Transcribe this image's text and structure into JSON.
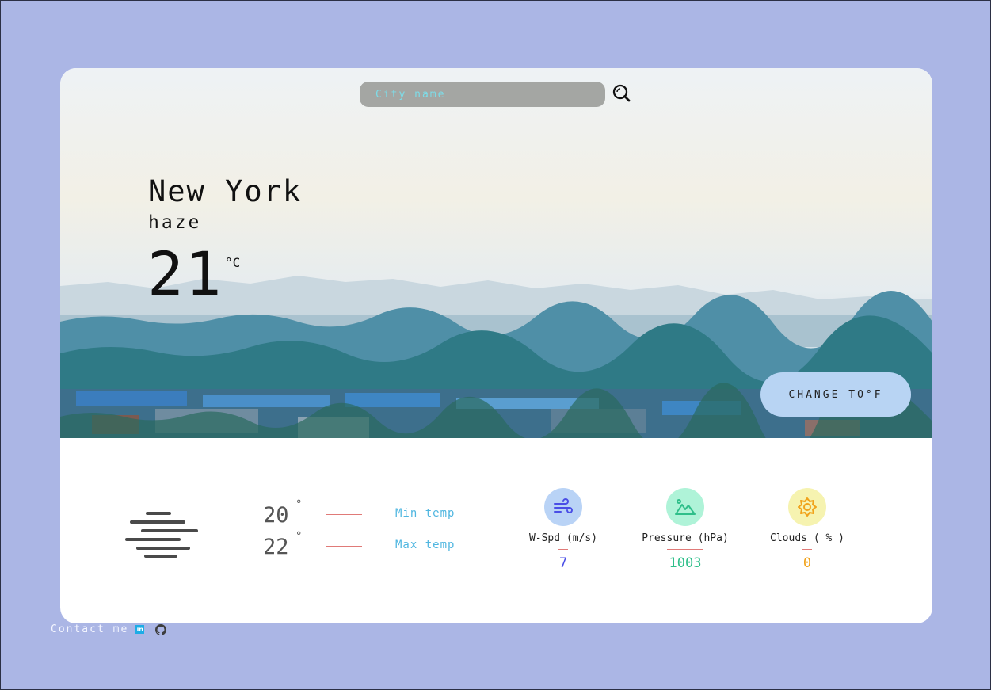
{
  "search": {
    "placeholder": "City name",
    "value": ""
  },
  "weather": {
    "city": "New York",
    "condition": "haze",
    "temperature": "21",
    "unit": "°C"
  },
  "toggle_button": {
    "label": "CHANGE TO°F"
  },
  "temps": {
    "min": {
      "value": "20",
      "deg": "°",
      "label": "Min temp"
    },
    "max": {
      "value": "22",
      "deg": "°",
      "label": "Max temp"
    }
  },
  "stats": [
    {
      "label": "W-Spd (m/s)",
      "value": "7",
      "icon": "wind-icon",
      "color": "#4a4ee6",
      "bg": "#b9d3f6"
    },
    {
      "label": "Pressure (hPa)",
      "value": "1003",
      "icon": "mountain-icon",
      "color": "#2fbf8a",
      "bg": "#aff3d8"
    },
    {
      "label": "Clouds ( % )",
      "value": "0",
      "icon": "sun-icon",
      "color": "#f1a21a",
      "bg": "#f6f3b0"
    }
  ],
  "footer": {
    "contact_label": "Contact me"
  },
  "colors": {
    "background": "#abb6e5",
    "toggle": "#b8d4f3",
    "accent_label": "#4fb6e0"
  }
}
